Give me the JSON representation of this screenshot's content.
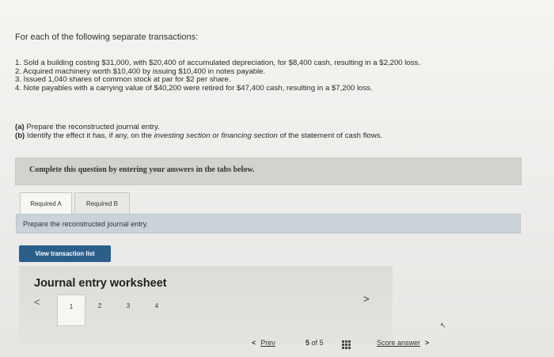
{
  "intro": "For each of the following separate transactions:",
  "transactions": [
    "1. Sold a building costing $31,000, with $20,400 of accumulated depreciation, for $8,400 cash, resulting in a $2,200 loss.",
    "2. Acquired machinery worth $10,400 by issuing $10,400 in notes payable.",
    "3. Issued 1,040 shares of common stock at par for $2 per share.",
    "4. Note payables with a carrying value of $40,200 were retired for $47,400 cash, resulting in a $7,200 loss."
  ],
  "parts": {
    "a_marker": "(a)",
    "a_text": "Prepare the reconstructed journal entry.",
    "b_marker": "(b)",
    "b_text_1": "Identify the effect it has, if any, on the",
    "b_text_italic": "investing section or financing section",
    "b_text_2": "of the statement of cash flows."
  },
  "banner": "Complete this question by entering your answers in the tabs below.",
  "tabs": [
    "Required A",
    "Required B"
  ],
  "tab_instruction": "Prepare the reconstructed journal entry.",
  "view_button": "View transaction list",
  "worksheet": {
    "title": "Journal entry worksheet",
    "prev_glyph": "<",
    "next_glyph": ">",
    "pages": [
      "1",
      "2",
      "3",
      "4"
    ],
    "active_page": "1"
  },
  "footer": {
    "prev_glyph": "<",
    "prev_label": "Prev",
    "current": "5",
    "of_label": "of",
    "total": "5",
    "score_label": "Score answer",
    "score_glyph": ">"
  },
  "colors": {
    "button_bg": "#2b5e8b",
    "tabbar_bg": "#c9d3d8",
    "banner_bg": "#d2d2cf"
  }
}
